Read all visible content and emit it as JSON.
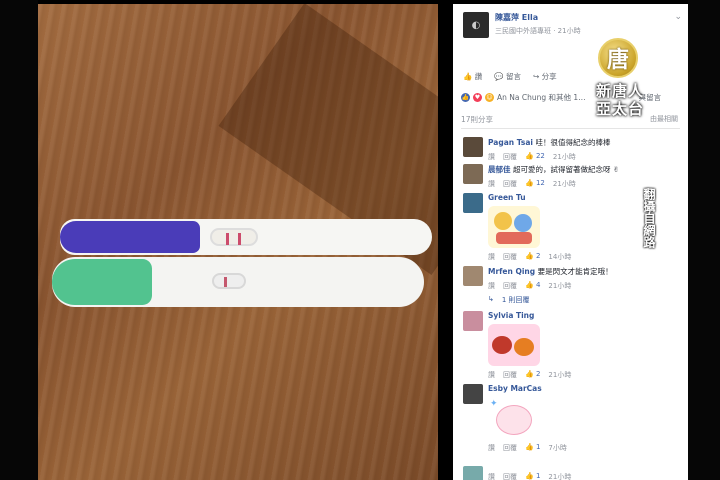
{
  "post": {
    "author": "陳嘉萍 Ella",
    "meta": "三民國中外語專班 · 21小時",
    "actions": [
      "讚",
      "留言",
      "分享"
    ],
    "reactions_text": "An Na Chung 和其他 1…",
    "reactions_suffix": "與留言",
    "shares": "17則分享",
    "sort": "由最相關"
  },
  "comments": [
    {
      "name": "Pagan Tsai",
      "text": "哇！很值得紀念的棒棒",
      "like": "讚",
      "reply": "回覆",
      "likes": "22",
      "time": "21小時"
    },
    {
      "name": "晨郁佳",
      "text": "超可愛的，試得留著做紀念呀 ✌",
      "like": "讚",
      "reply": "回覆",
      "likes": "12",
      "time": "21小時"
    },
    {
      "name": "Green Tu",
      "text": "",
      "like": "讚",
      "reply": "回覆",
      "likes": "2",
      "time": "14小時"
    },
    {
      "name": "Mrfen Qing",
      "text": "要是閃文才能肯定哦！",
      "like": "讚",
      "reply": "回覆",
      "likes": "4",
      "time": "21小時"
    },
    {
      "name": "Sylvia Ting",
      "text": "",
      "like": "讚",
      "reply": "回覆",
      "likes": "2",
      "time": "21小時"
    },
    {
      "name": "Esby MarCas",
      "text": "",
      "like": "讚",
      "reply": "回覆",
      "likes": "1",
      "time": "7小時"
    }
  ],
  "reply_link": "1 則回覆",
  "last_row": {
    "like": "讚",
    "reply": "回覆",
    "likes": "1",
    "time": "21小時"
  },
  "logo": {
    "glyph": "唐",
    "name": "新唐人亞太台"
  },
  "source_tag": "翻攝自網路",
  "colors": {
    "facebook_link": "#365899",
    "like_blue": "#4267b2",
    "purple_cap": "#4a3cb8",
    "green_cap": "#52c38f"
  }
}
